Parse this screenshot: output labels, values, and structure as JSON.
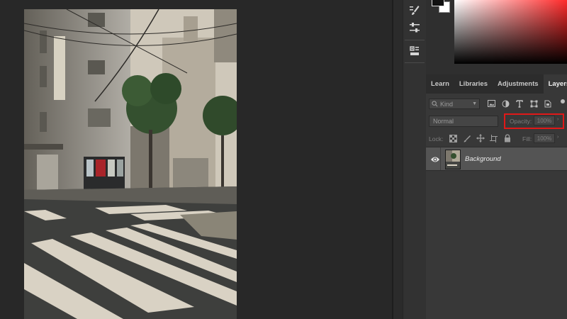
{
  "colors": {
    "accent_highlight": "#e01818",
    "panel_bg": "#383838",
    "canvas_bg": "#282828",
    "selected_layer_bg": "#545454"
  },
  "tool_strip": {
    "tools": [
      {
        "name": "brush-settings-icon"
      },
      {
        "name": "adjustments-sliders-icon"
      },
      {
        "name": "properties-icon"
      }
    ]
  },
  "panel_tabs": [
    {
      "label": "Learn",
      "active": false
    },
    {
      "label": "Libraries",
      "active": false
    },
    {
      "label": "Adjustments",
      "active": false
    },
    {
      "label": "Layers",
      "active": true
    }
  ],
  "layers": {
    "filter_kind": "Kind",
    "blend_mode": "Normal",
    "opacity_label": "Opacity:",
    "opacity_value": "100%",
    "lock_label": "Lock:",
    "fill_label": "Fill:",
    "fill_value": "100%",
    "items": [
      {
        "name": "Background",
        "visible": true
      }
    ]
  }
}
